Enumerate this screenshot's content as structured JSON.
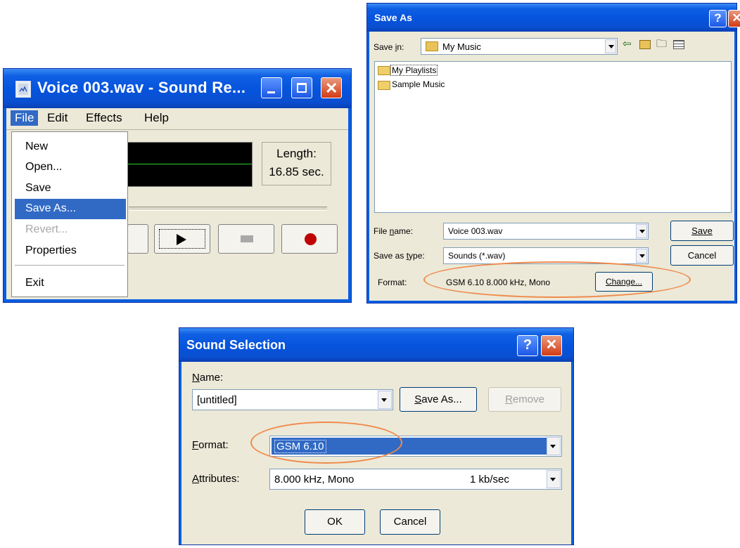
{
  "sound_recorder": {
    "title": "Voice 003.wav - Sound Re...",
    "menubar": [
      "File",
      "Edit",
      "Effects",
      "Help"
    ],
    "length_label": "Length:",
    "length_value": "16.85 sec.",
    "file_menu": {
      "items": [
        "New",
        "Open...",
        "Save",
        "Save As...",
        "Revert...",
        "Properties",
        "Exit"
      ],
      "highlighted": "Save As...",
      "disabled": [
        "Revert..."
      ]
    }
  },
  "save_as": {
    "title": "Save As",
    "save_in_label": "Save in:",
    "save_in_value": "My Music",
    "folders": [
      "My Playlists",
      "Sample Music"
    ],
    "file_name_label": "File name:",
    "file_name_value": "Voice 003.wav",
    "save_as_type_label": "Save as type:",
    "save_as_type_value": "Sounds (*.wav)",
    "format_label": "Format:",
    "format_value": "GSM 6.10 8.000 kHz, Mono",
    "save_button": "Save",
    "cancel_button": "Cancel",
    "change_button": "Change..."
  },
  "sound_selection": {
    "title": "Sound Selection",
    "name_label": "Name:",
    "name_value": "[untitled]",
    "save_as_button": "Save As...",
    "remove_button": "Remove",
    "format_label": "Format:",
    "format_value": "GSM 6.10",
    "attributes_label": "Attributes:",
    "attributes_value": "8.000 kHz, Mono",
    "attributes_rate": "1 kb/sec",
    "ok_button": "OK",
    "cancel_button": "Cancel"
  },
  "colors": {
    "xp_blue": "#0a5ee0",
    "dialog_face": "#ece9d8",
    "selection": "#316ac5",
    "highlight_oval": "#f08a4b",
    "record_dot": "#c00000"
  }
}
